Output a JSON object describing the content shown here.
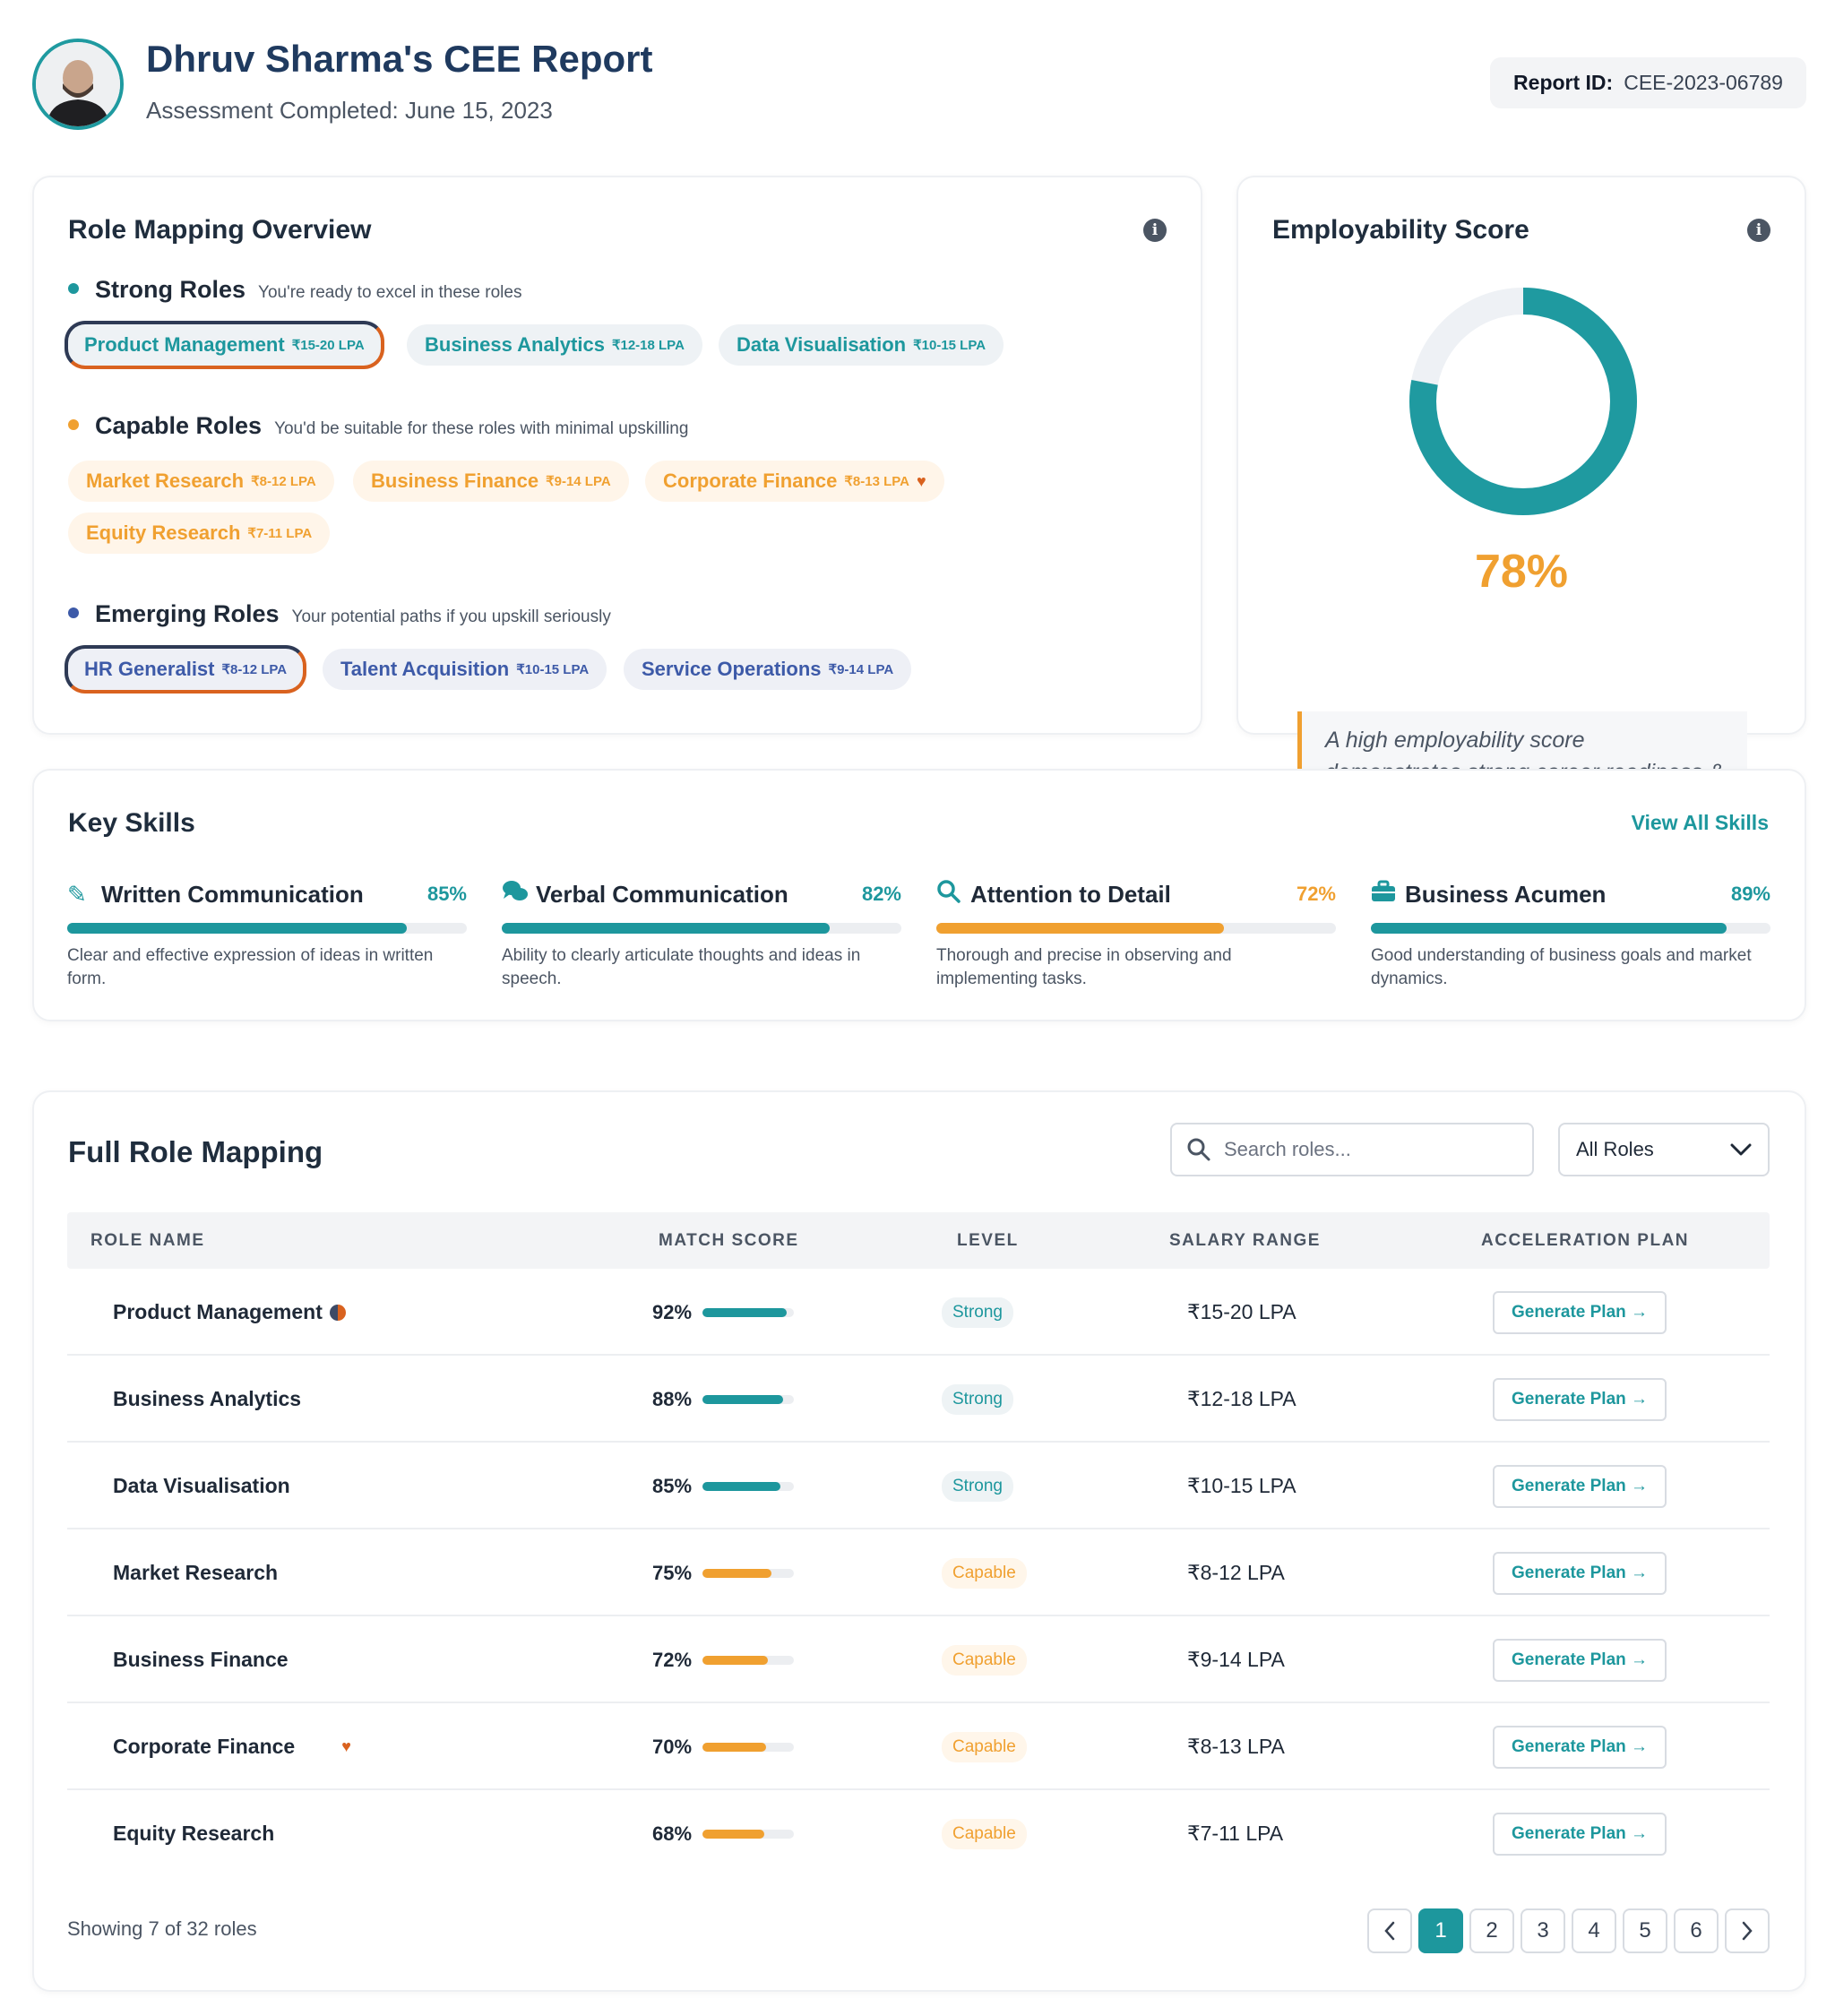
{
  "header": {
    "title": "Dhruv Sharma's CEE Report",
    "subtitle": "Assessment Completed: June 15, 2023",
    "report_id_label": "Report ID:",
    "report_id_value": "CEE-2023-06789"
  },
  "role_overview": {
    "title": "Role Mapping Overview",
    "groups": [
      {
        "name": "Strong Roles",
        "desc": "You're ready to excel in these roles",
        "color": "#1d979d",
        "roles": [
          {
            "name": "Product Management",
            "salary": "₹15-20 LPA"
          },
          {
            "name": "Business Analytics",
            "salary": "₹12-18 LPA"
          },
          {
            "name": "Data Visualisation",
            "salary": "₹10-15 LPA"
          }
        ]
      },
      {
        "name": "Capable Roles",
        "desc": "You'd be suitable for these roles with minimal upskilling",
        "color": "#f0a030",
        "roles": [
          {
            "name": "Market Research",
            "salary": "₹8-12 LPA"
          },
          {
            "name": "Business Finance",
            "salary": "₹9-14 LPA"
          },
          {
            "name": "Corporate Finance",
            "salary": "₹8-13 LPA"
          },
          {
            "name": "Equity Research",
            "salary": "₹7-11 LPA"
          }
        ]
      },
      {
        "name": "Emerging Roles",
        "desc": "Your potential paths if you upskill seriously",
        "color": "#3d5aa8",
        "roles": [
          {
            "name": "HR Generalist",
            "salary": "₹8-12 LPA"
          },
          {
            "name": "Talent Acquisition",
            "salary": "₹10-15 LPA"
          },
          {
            "name": "Service Operations",
            "salary": "₹9-14 LPA"
          }
        ]
      }
    ]
  },
  "employability": {
    "title": "Employability Score",
    "score_text": "78%",
    "score": 0.78,
    "quote": "A high employability score demonstrates strong career readiness & suitability for your top mapped roles"
  },
  "skills": {
    "title": "Key Skills",
    "view_all": "View All Skills",
    "items": [
      {
        "name": "Written Communication",
        "pct_text": "85%",
        "pct": 0.85,
        "color": "#1d979d",
        "icon": "pencil-icon",
        "desc": "Clear and effective expression of ideas in written form."
      },
      {
        "name": "Verbal Communication",
        "pct_text": "82%",
        "pct": 0.82,
        "color": "#1d979d",
        "icon": "chat-bubbles-icon",
        "desc": "Ability to clearly articulate thoughts and ideas in speech."
      },
      {
        "name": "Attention to Detail",
        "pct_text": "72%",
        "pct": 0.72,
        "color": "#f0a030",
        "icon": "magnifier-icon",
        "desc": "Thorough and precise in observing and implementing tasks."
      },
      {
        "name": "Business Acumen",
        "pct_text": "89%",
        "pct": 0.89,
        "color": "#1d979d",
        "icon": "briefcase-icon",
        "desc": "Good understanding of business goals and market dynamics."
      }
    ]
  },
  "table": {
    "title": "Full Role Mapping",
    "search_placeholder": "Search roles...",
    "filter_value": "All Roles",
    "columns": [
      "ROLE NAME",
      "MATCH SCORE",
      "LEVEL",
      "SALARY RANGE",
      "ACCELERATION PLAN"
    ],
    "button_label": "Generate Plan →",
    "rows": [
      {
        "role": "Product Management",
        "score_text": "92%",
        "score": 0.92,
        "level": "Strong",
        "salary": "₹15-20 LPA"
      },
      {
        "role": "Business Analytics",
        "score_text": "88%",
        "score": 0.88,
        "level": "Strong",
        "salary": "₹12-18 LPA"
      },
      {
        "role": "Data Visualisation",
        "score_text": "85%",
        "score": 0.85,
        "level": "Strong",
        "salary": "₹10-15 LPA"
      },
      {
        "role": "Market Research",
        "score_text": "75%",
        "score": 0.75,
        "level": "Capable",
        "salary": "₹8-12 LPA"
      },
      {
        "role": "Business Finance",
        "score_text": "72%",
        "score": 0.72,
        "level": "Capable",
        "salary": "₹9-14 LPA"
      },
      {
        "role": "Corporate Finance",
        "score_text": "70%",
        "score": 0.7,
        "level": "Capable",
        "salary": "₹8-13 LPA"
      },
      {
        "role": "Equity Research",
        "score_text": "68%",
        "score": 0.68,
        "level": "Capable",
        "salary": "₹7-11 LPA"
      }
    ],
    "showing": "Showing 7 of 32 roles",
    "pages": [
      "1",
      "2",
      "3",
      "4",
      "5",
      "6"
    ],
    "active_page": "1",
    "prev_icon": "chevron-left-icon",
    "next_icon": "chevron-right-icon"
  },
  "colors": {
    "teal": "#1d979d",
    "orange": "#f0a030",
    "navy": "#1f3a5f",
    "accent_orange": "#d9621f"
  }
}
